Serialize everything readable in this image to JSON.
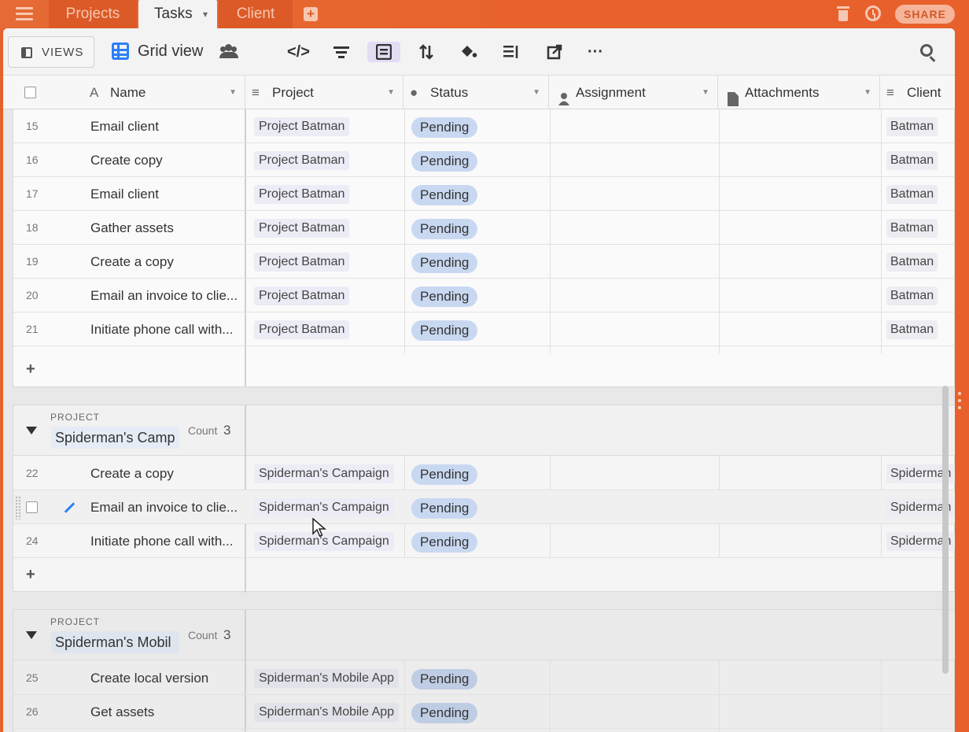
{
  "topbar": {
    "tabs": [
      {
        "label": "Projects"
      },
      {
        "label": "Tasks",
        "caret": "▾"
      },
      {
        "label": "Client"
      }
    ],
    "share_label": "SHARE",
    "icons": [
      "hamburger-icon",
      "add-tab-icon",
      "trash-icon",
      "history-icon"
    ]
  },
  "toolbar": {
    "views_label": "VIEWS",
    "view_name": "Grid view",
    "icons": [
      "collaborators-icon",
      "code-icon",
      "filter-icon",
      "group-icon",
      "sort-icon",
      "color-icon",
      "row-height-icon",
      "share-view-icon",
      "more-icon",
      "search-icon"
    ],
    "code_glyph": "</>",
    "more_glyph": "···"
  },
  "columns": [
    {
      "label": "Name",
      "icon": "A"
    },
    {
      "label": "Project",
      "icon": "≡"
    },
    {
      "label": "Status",
      "icon": "●"
    },
    {
      "label": "Assignment",
      "icon": "person"
    },
    {
      "label": "Attachments",
      "icon": "file"
    },
    {
      "label": "Client",
      "icon": "≡"
    }
  ],
  "group_label": "PROJECT",
  "count_label": "Count",
  "add_symbol": "+",
  "groups": [
    {
      "value": "",
      "count": "",
      "rows": [
        {
          "num": "15",
          "name": "Email client",
          "project": "Project Batman",
          "status": "Pending",
          "client": "Batman"
        },
        {
          "num": "16",
          "name": "Create copy",
          "project": "Project Batman",
          "status": "Pending",
          "client": "Batman"
        },
        {
          "num": "17",
          "name": "Email client",
          "project": "Project Batman",
          "status": "Pending",
          "client": "Batman"
        },
        {
          "num": "18",
          "name": "Gather assets",
          "project": "Project Batman",
          "status": "Pending",
          "client": "Batman"
        },
        {
          "num": "19",
          "name": "Create a copy",
          "project": "Project Batman",
          "status": "Pending",
          "client": "Batman"
        },
        {
          "num": "20",
          "name": "Email an invoice to clie...",
          "project": "Project Batman",
          "status": "Pending",
          "client": "Batman"
        },
        {
          "num": "21",
          "name": "Initiate phone call with...",
          "project": "Project Batman",
          "status": "Pending",
          "client": "Batman"
        }
      ]
    },
    {
      "value": "Spiderman's Camp",
      "count": "3",
      "rows": [
        {
          "num": "22",
          "name": "Create a copy",
          "project": "Spiderman's Campaign",
          "status": "Pending",
          "client": "Spiderman"
        },
        {
          "num": "",
          "name": "Email an invoice to clie...",
          "project": "Spiderman's Campaign",
          "status": "Pending",
          "client": "Spiderman"
        },
        {
          "num": "24",
          "name": "Initiate phone call with...",
          "project": "Spiderman's Campaign",
          "status": "Pending",
          "client": "Spiderman"
        }
      ]
    },
    {
      "value": "Spiderman's Mobil",
      "count": "3",
      "rows": [
        {
          "num": "25",
          "name": "Create local version",
          "project": "Spiderman's Mobile App",
          "status": "Pending",
          "client": ""
        },
        {
          "num": "26",
          "name": "Get assets",
          "project": "Spiderman's Mobile App",
          "status": "Pending",
          "client": ""
        }
      ]
    }
  ],
  "colors": {
    "brand_orange": "#e8612c",
    "status_pill": "#c9d8f1",
    "accent_blue": "#2d7ff9"
  }
}
